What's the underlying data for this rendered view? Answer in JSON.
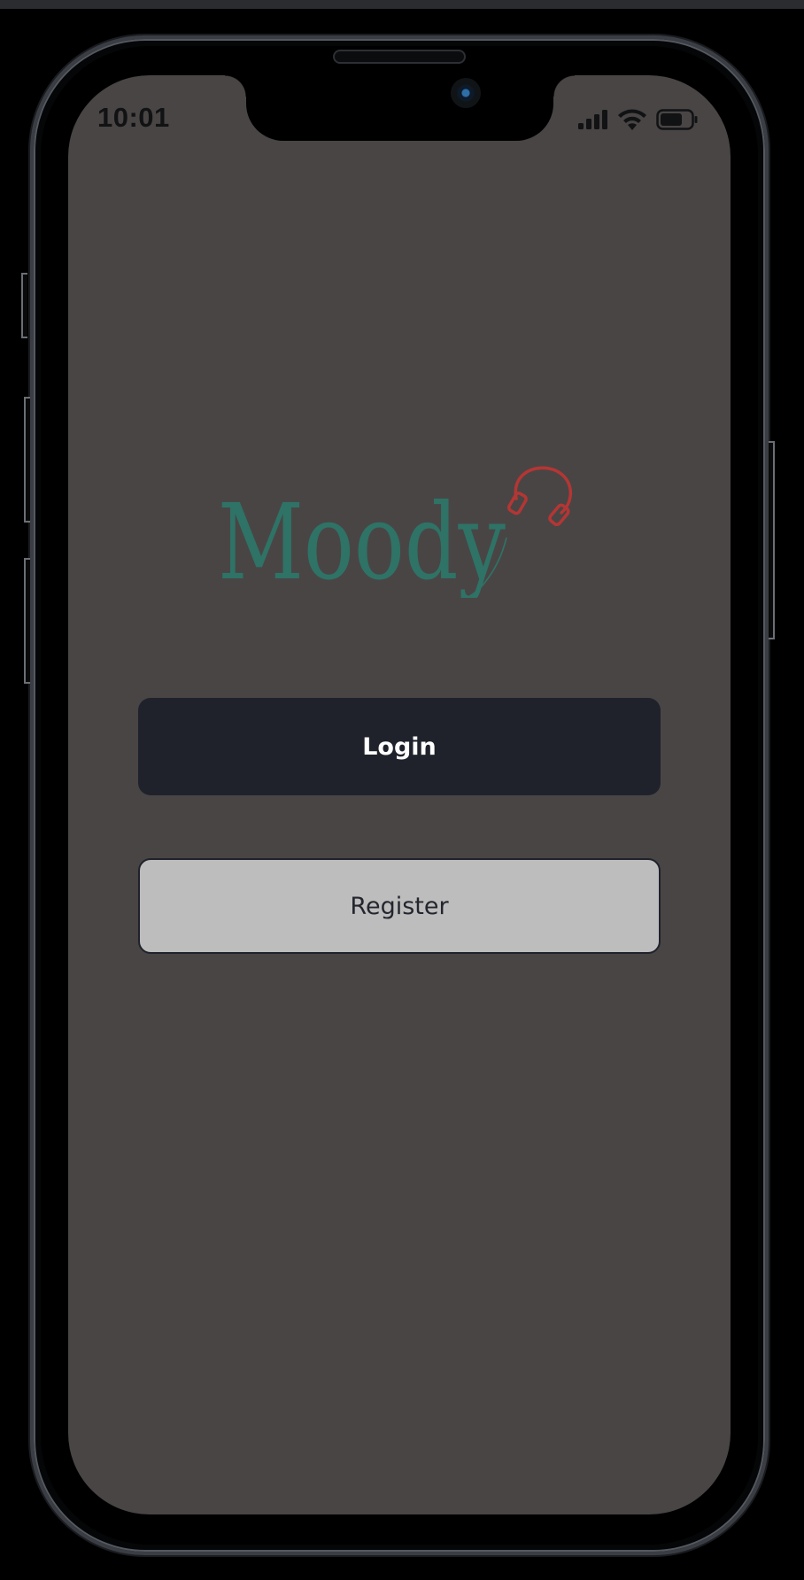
{
  "status_bar": {
    "time": "10:01"
  },
  "brand": {
    "logo_text": "Moody",
    "logo_color": "#2e7366",
    "accent_color": "#b43634"
  },
  "actions": {
    "login_label": "Login",
    "register_label": "Register"
  },
  "colors": {
    "screen_background": "#494545",
    "login_button": "#1f222b",
    "register_button": "#bdbdbd"
  },
  "icons": {
    "signal": "cellular-signal-icon",
    "wifi": "wifi-icon",
    "battery": "battery-icon",
    "headphones": "headphones-icon"
  }
}
